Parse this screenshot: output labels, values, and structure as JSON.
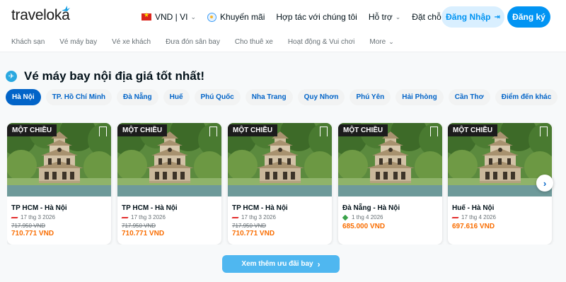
{
  "header": {
    "logo": "traveloka",
    "currency_lang": "VND | VI",
    "promo": "Khuyến mãi",
    "partner": "Hợp tác với chúng tôi",
    "support": "Hỗ trợ",
    "bookings": "Đặt chỗ của tôi",
    "login": "Đăng Nhập",
    "signup": "Đăng ký"
  },
  "subnav": [
    "Khách sạn",
    "Vé máy bay",
    "Vé xe khách",
    "Đưa đón sân bay",
    "Cho thuê xe",
    "Hoạt động & Vui chơi",
    "More"
  ],
  "section": {
    "title": "Vé máy bay nội địa giá tốt nhất!"
  },
  "chips": [
    "Hà Nội",
    "TP. Hồ Chí Minh",
    "Đà Nẵng",
    "Huế",
    "Phú Quốc",
    "Nha Trang",
    "Quy Nhơn",
    "Phú Yên",
    "Hải Phòng",
    "Cần Thơ",
    "Điểm đến khác"
  ],
  "active_chip": "Hà Nội",
  "cards": [
    {
      "badge": "MỘT CHIỀU",
      "route": "TP HCM - Hà Nội",
      "date": "17 thg 3 2026",
      "old_price": "717.950 VND",
      "price": "710.771 VND",
      "airline": "red"
    },
    {
      "badge": "MỘT CHIỀU",
      "route": "TP HCM - Hà Nội",
      "date": "17 thg 3 2026",
      "old_price": "717.950 VND",
      "price": "710.771 VND",
      "airline": "red"
    },
    {
      "badge": "MỘT CHIỀU",
      "route": "TP HCM - Hà Nội",
      "date": "17 thg 3 2026",
      "old_price": "717.950 VND",
      "price": "710.771 VND",
      "airline": "red"
    },
    {
      "badge": "MỘT CHIỀU",
      "route": "Đà Nẵng - Hà Nội",
      "date": "1 thg 4 2026",
      "old_price": "",
      "price": "685.000 VND",
      "airline": "green"
    },
    {
      "badge": "MỘT CHIỀU",
      "route": "Huế - Hà Nội",
      "date": "17 thg 4 2026",
      "old_price": "",
      "price": "697.616 VND",
      "airline": "red"
    }
  ],
  "more_button": "Xem thêm ưu đãi bay",
  "colors": {
    "brand": "#0194f3",
    "chip_active": "#0264c8",
    "price": "#f96d01"
  }
}
